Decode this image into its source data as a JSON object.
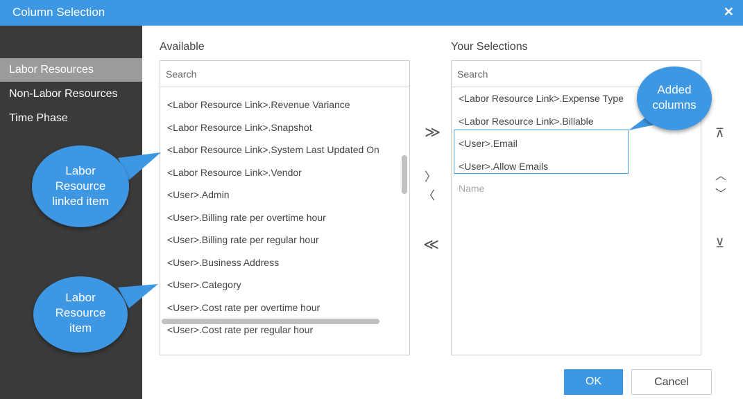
{
  "dialog": {
    "title": "Column Selection",
    "close_glyph": "✕"
  },
  "sidebar": {
    "items": [
      {
        "label": "Labor Resources"
      },
      {
        "label": "Non-Labor Resources"
      },
      {
        "label": "Time Phase"
      }
    ]
  },
  "available": {
    "title": "Available",
    "search_placeholder": "Search",
    "items": [
      "<Labor Resource Link>.Revenue Variance",
      "<Labor Resource Link>.Snapshot",
      "<Labor Resource Link>.System Last Updated On",
      "<Labor Resource Link>.Vendor",
      "<User>.Admin",
      "<User>.Billing rate per overtime hour",
      "<User>.Billing rate per regular hour",
      "<User>.Business Address",
      "<User>.Category",
      "<User>.Cost rate per overtime hour",
      "<User>.Cost rate per regular hour"
    ]
  },
  "selections": {
    "title": "Your Selections",
    "search_placeholder": "Search",
    "items": [
      "<Labor Resource Link>.Expense Type",
      "<Labor Resource Link>.Billable",
      "<User>.Email",
      "<User>.Allow Emails"
    ],
    "placeholder_item": "Name"
  },
  "transfer": {
    "add_all": "≫",
    "add": "〉",
    "remove": "〈",
    "remove_all": "≪"
  },
  "order": {
    "move_top": "⊼",
    "move_up": "︿",
    "move_down": "﹀",
    "move_bottom": "⊻"
  },
  "buttons": {
    "ok": "OK",
    "cancel": "Cancel"
  },
  "callouts": {
    "linked": [
      "Labor",
      "Resource",
      "linked item"
    ],
    "item": [
      "Labor",
      "Resource",
      "item"
    ],
    "added": [
      "Added",
      "columns"
    ]
  },
  "colors": {
    "accent": "#3d97e3",
    "sidebar": "#3a3a3a",
    "sidebar_active": "#9b9b9b"
  }
}
